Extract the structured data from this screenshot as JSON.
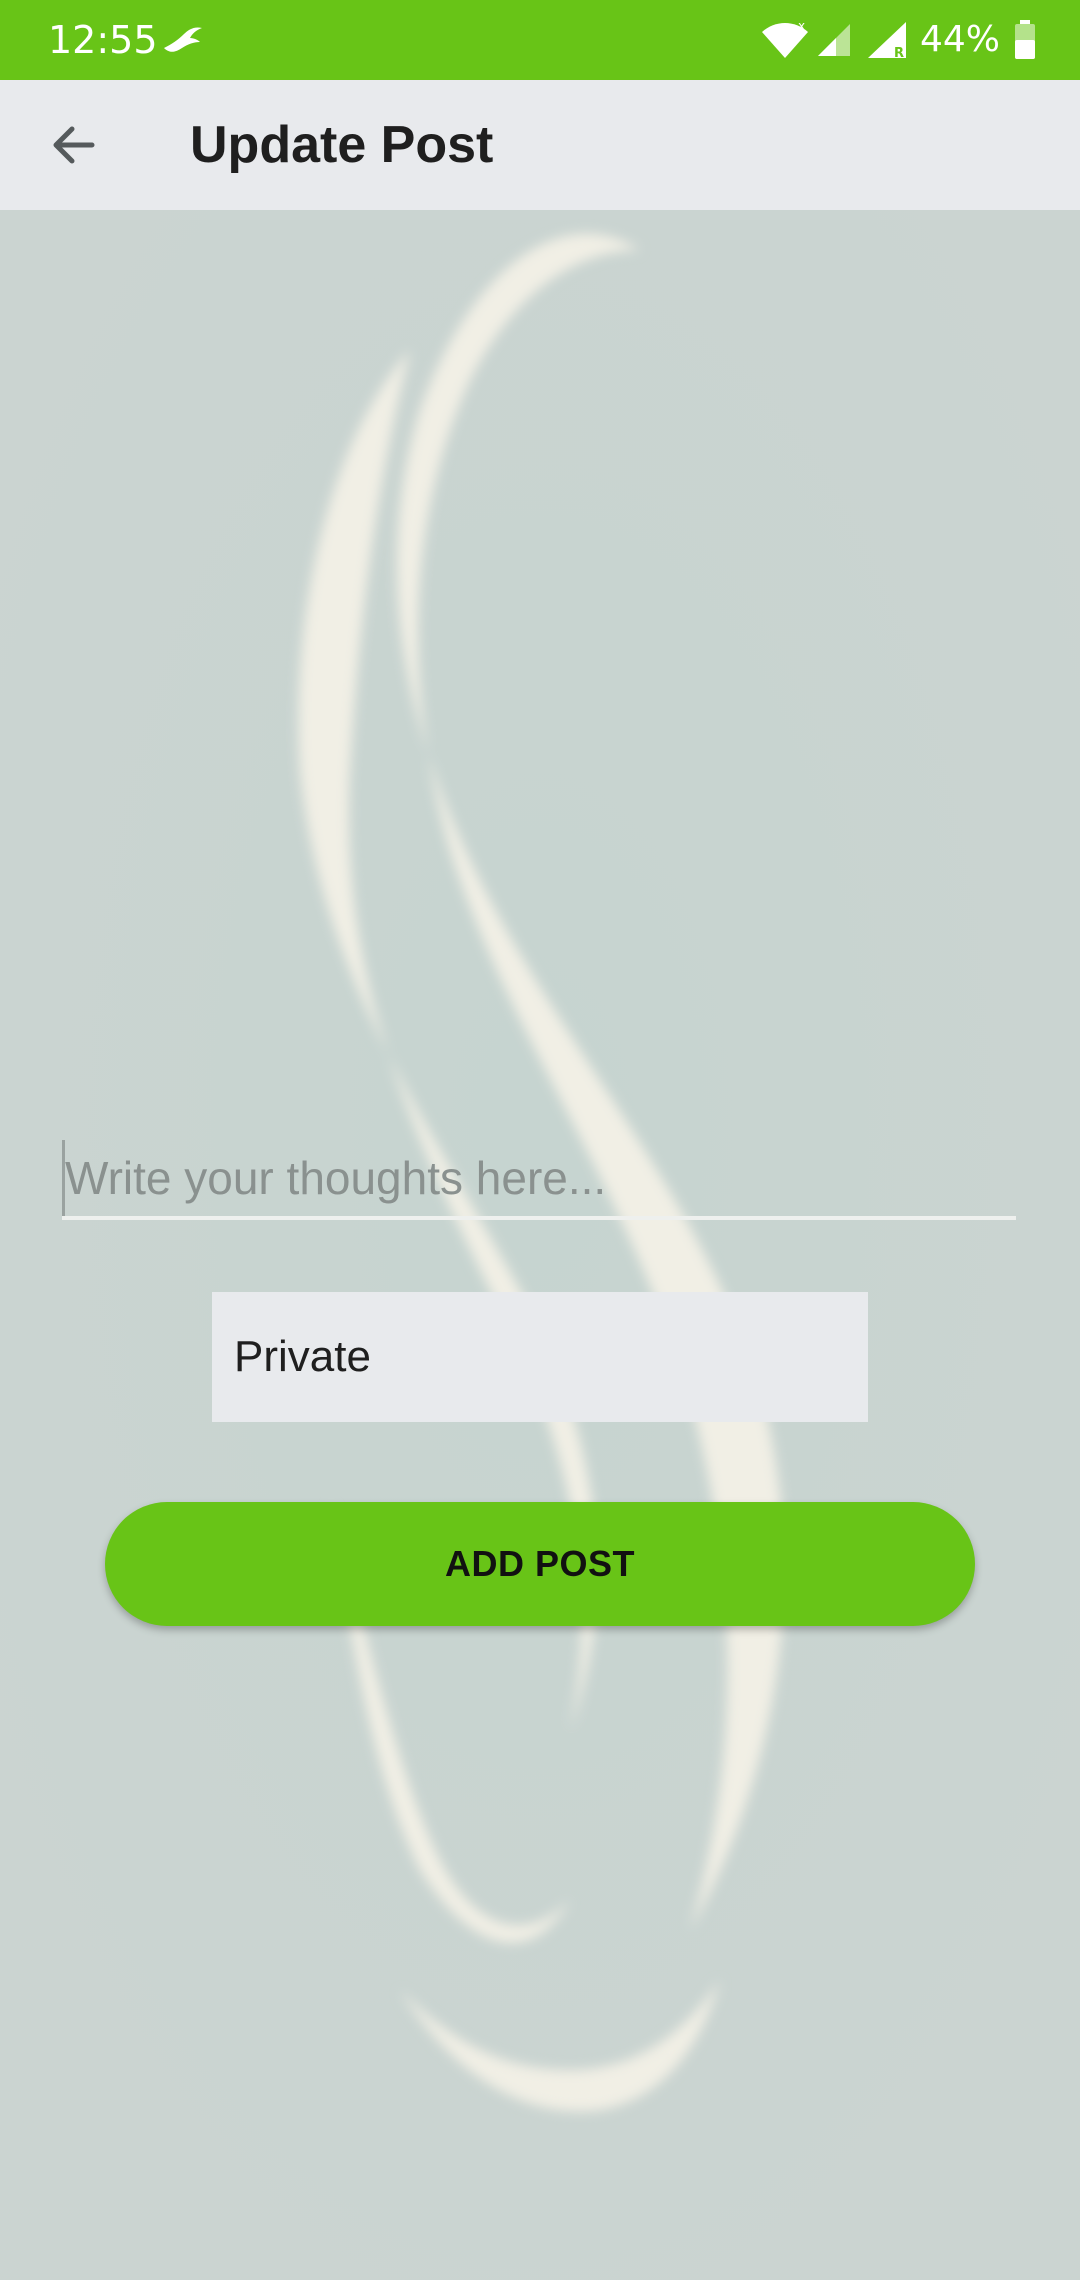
{
  "status_bar": {
    "time": "12:55",
    "battery": "44%",
    "background_color": "#68c417",
    "icons": [
      "bird-icon",
      "wifi-icon",
      "signal-icon",
      "signal-roaming-icon",
      "battery-icon"
    ]
  },
  "app_bar": {
    "title": "Update Post",
    "back_icon": "arrow-left-icon"
  },
  "form": {
    "post_placeholder": "Write your thoughts here...",
    "post_value": "",
    "privacy_value": "Private",
    "submit_label": "ADD POST"
  },
  "theme": {
    "accent": "#68c417",
    "background": "#cad5d1"
  }
}
